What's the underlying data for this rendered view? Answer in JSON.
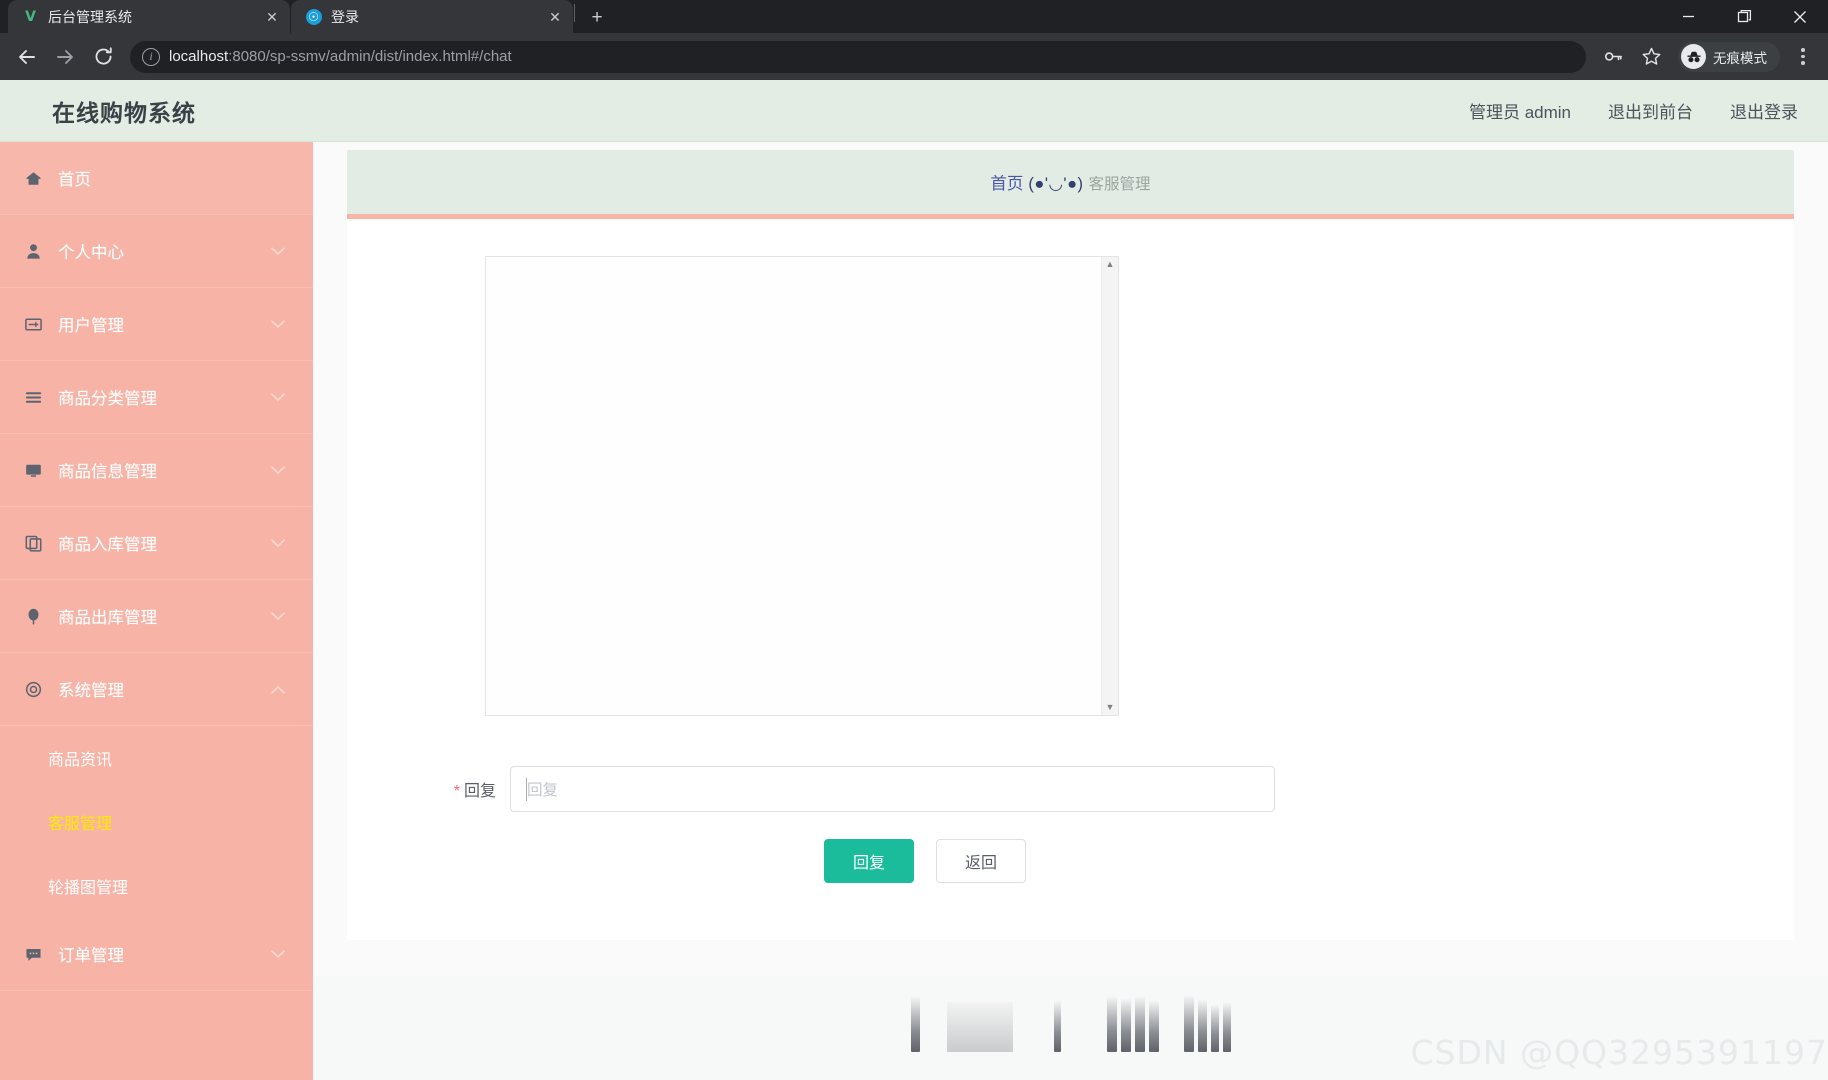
{
  "browser": {
    "tabs": [
      {
        "title": "后台管理系统",
        "favicon": "vue-logo-icon",
        "active": true,
        "close_label": "✕"
      },
      {
        "title": "登录",
        "favicon": "globe-icon",
        "active": false,
        "close_label": "✕"
      }
    ],
    "new_tab_label": "+",
    "window_controls": {
      "minimize": "minimize-icon",
      "maximize": "maximize-icon",
      "close": "close-icon"
    },
    "toolbar": {
      "back": "back-arrow-icon",
      "forward": "forward-arrow-icon",
      "reload": "reload-icon",
      "site_info": "i",
      "url_host": "localhost",
      "url_rest": ":8080/sp-ssmv/admin/dist/index.html#/chat",
      "url_full": "localhost:8080/sp-ssmv/admin/dist/index.html#/chat",
      "password_icon": "key-icon",
      "bookmark_icon": "star-icon",
      "incognito_label": "无痕模式",
      "incognito_icon": "incognito-hat-icon",
      "menu_icon": "kebab-menu-icon"
    }
  },
  "app": {
    "header": {
      "title": "在线购物系统",
      "nav": [
        {
          "label": "管理员 admin",
          "name": "current-user"
        },
        {
          "label": "退出到前台",
          "name": "exit-to-frontend"
        },
        {
          "label": "退出登录",
          "name": "logout"
        }
      ]
    },
    "sidebar": {
      "items": [
        {
          "label": "首页",
          "icon": "home-icon",
          "expandable": false,
          "active": true
        },
        {
          "label": "个人中心",
          "icon": "user-icon",
          "expandable": true,
          "chevron": "⌄"
        },
        {
          "label": "用户管理",
          "icon": "id-card-icon",
          "expandable": true,
          "chevron": "⌄"
        },
        {
          "label": "商品分类管理",
          "icon": "list-icon",
          "expandable": true,
          "chevron": "⌄"
        },
        {
          "label": "商品信息管理",
          "icon": "monitor-icon",
          "expandable": true,
          "chevron": "⌄"
        },
        {
          "label": "商品入库管理",
          "icon": "copy-icon",
          "expandable": true,
          "chevron": "⌄"
        },
        {
          "label": "商品出库管理",
          "icon": "balloon-icon",
          "expandable": true,
          "chevron": "⌄"
        },
        {
          "label": "系统管理",
          "icon": "gear-icon",
          "expandable": true,
          "expanded": true,
          "chevron": "⌃"
        }
      ],
      "submenu": [
        {
          "label": "商品资讯",
          "active": false
        },
        {
          "label": "客服管理",
          "active": true
        },
        {
          "label": "轮播图管理",
          "active": false
        }
      ],
      "last_item": {
        "label": "订单管理",
        "icon": "comment-icon",
        "expandable": true,
        "chevron": "⌄"
      }
    },
    "breadcrumb": {
      "home": "首页",
      "emoticon": "(●'◡'●)",
      "current": "客服管理"
    },
    "chat": {
      "messages": [],
      "scroll_up": "▲",
      "scroll_down": "▼"
    },
    "form": {
      "required_mark": "*",
      "label": "回复",
      "placeholder": "回复",
      "value": "",
      "submit_label": "回复",
      "back_label": "返回"
    }
  },
  "watermark": "CSDN @QQ3295391197",
  "colors": {
    "sidebar_bg": "#f7b3a6",
    "header_bg": "#e3ede4",
    "accent_green": "#1abc9c",
    "active_submenu": "#ffe900",
    "crumb_link": "#4a57a8",
    "crumb_border": "#f5b5a8"
  }
}
